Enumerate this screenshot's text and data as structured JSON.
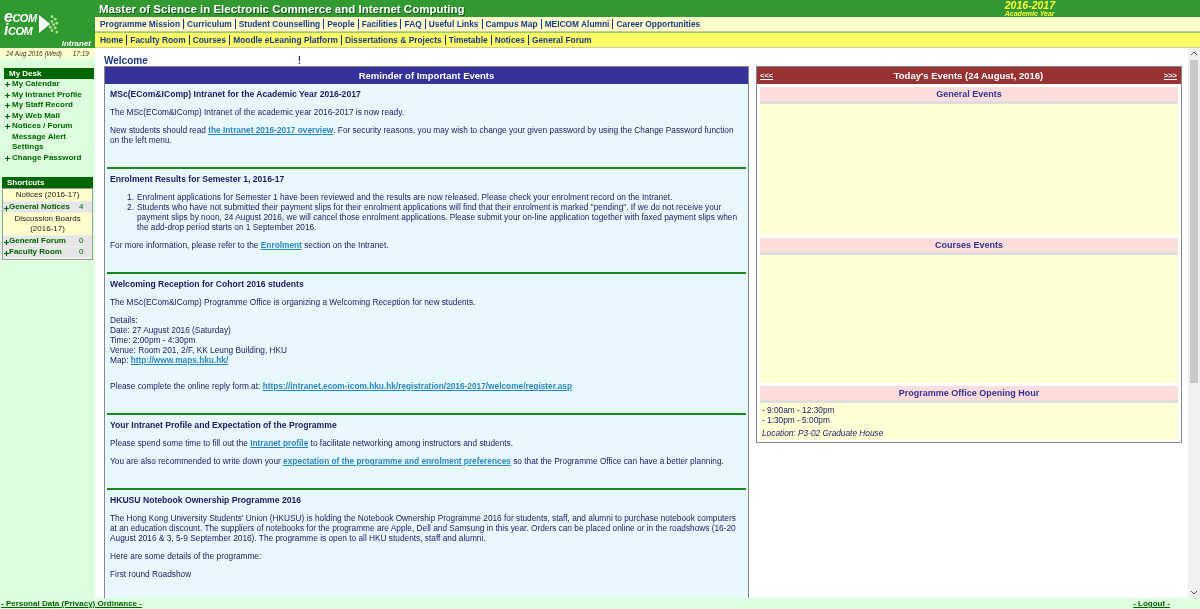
{
  "logo": {
    "top": "eCOM",
    "bottom": "iCOM",
    "tag": "Intranet"
  },
  "header": {
    "title": "Master of Science in Electronic Commerce and Internet Computing",
    "year": "2016-2017",
    "year_caption": "Academic Year"
  },
  "nav_primary": [
    "Programme Mission",
    "Curriculum",
    "Student Counselling",
    "People",
    "Facilities",
    "FAQ",
    "Useful Links",
    "Campus Map",
    "MEICOM Alumni",
    "Career Opportunities"
  ],
  "nav_secondary": [
    "Home",
    "Faculty Room",
    "Courses",
    "Moodle eLeaning Platform",
    "Dissertations & Projects",
    "Timetable",
    "Notices",
    "General Forum"
  ],
  "datetime": {
    "date": "24 Aug 2016 (Wed)",
    "time": "17:19"
  },
  "my_desk": {
    "title": "My Desk",
    "items": [
      {
        "label": "My Calendar"
      },
      {
        "label": "My Intranet Profile"
      },
      {
        "label": "My Staff Record"
      },
      {
        "label": "My Web Mail"
      },
      {
        "label": "Notices / Forum Message Alert Settings"
      },
      {
        "label": "Change Password"
      }
    ]
  },
  "shortcuts": {
    "title": "Shortcuts",
    "rows": [
      {
        "kind": "group",
        "label": "Notices (2016-17)"
      },
      {
        "kind": "link",
        "label": "General Notices",
        "count": "4"
      },
      {
        "kind": "group",
        "label": "Discussion Boards (2016-17)"
      },
      {
        "kind": "link",
        "label": "General Forum",
        "count": "0"
      },
      {
        "kind": "link",
        "label": "Faculty Room",
        "count": "0"
      }
    ]
  },
  "welcome": {
    "greeting": "Welcome",
    "mark": "!"
  },
  "reminder": {
    "title": "Reminder of Important Events",
    "sections": [
      {
        "title": "MSc(ECom&IComp) Intranet for the Academic Year 2016-2017",
        "blocks": [
          {
            "kind": "para",
            "parts": [
              {
                "text": "The MSc(ECom&IComp) Intranet of the academic year 2016-2017 is now ready."
              }
            ]
          },
          {
            "kind": "para",
            "parts": [
              {
                "text": "New students should read "
              },
              {
                "text": "the Intranet 2016-2017 overview",
                "link": true
              },
              {
                "text": ".  For security reasons, you may wish to change your given password by using the Change Password function on the left menu."
              }
            ]
          }
        ]
      },
      {
        "title": "Enrolment Results for Semester 1, 2016-17",
        "blocks": [
          {
            "kind": "list",
            "items": [
              {
                "marker": "1.",
                "text": "Enrolment applications for Semester 1 have been reviewed and the results are now released.  Please check your enrolment record on the Intranet."
              },
              {
                "marker": "2.",
                "text": "Students who have not submitted their payment slips for their enrolment applications will find that their enrolment is marked \"pending\". If we do not receive your payment slips by noon, 24 August 2016, we will cancel those enrolment applications. Please submit your on-line application together with faxed payment slips when the add-drop period starts on 1 September 2016."
              }
            ]
          },
          {
            "kind": "para",
            "parts": [
              {
                "text": "For more information, please refer to the "
              },
              {
                "text": "Enrolment",
                "link": true
              },
              {
                "text": " section on the Intranet."
              }
            ]
          }
        ]
      },
      {
        "title": "Welcoming Reception for Cohort 2016 students",
        "blocks": [
          {
            "kind": "para",
            "parts": [
              {
                "text": "The MSc(ECom&IComp) Programme Office is organizing a Welcoming Reception for new students."
              }
            ]
          },
          {
            "kind": "lines",
            "lines": [
              [
                {
                  "text": "Details:"
                }
              ],
              [
                {
                  "text": "Date: 27 August 2016 (Saturday)"
                }
              ],
              [
                {
                  "text": "Time: 2:00pm - 4:30pm"
                }
              ],
              [
                {
                  "text": "Venue: Room 201, 2/F, KK Leung Building, HKU"
                }
              ],
              [
                {
                  "text": "Map: "
                },
                {
                  "text": "http://www.maps.hku.hk/",
                  "link": true
                }
              ]
            ]
          },
          {
            "kind": "para",
            "parts": [
              {
                "text": "Please complete the online reply form at: "
              },
              {
                "text": "https://intranet.ecom-icom.hku.hk/registration/2016-2017/welcome/register.asp",
                "link": true
              }
            ]
          }
        ]
      },
      {
        "title": "Your Intranet Profile and Expectation of the Programme",
        "blocks": [
          {
            "kind": "para",
            "parts": [
              {
                "text": "Please spend some time to fill out the "
              },
              {
                "text": "Intranet profile",
                "link": true
              },
              {
                "text": " to facilitate networking among instructors and students."
              }
            ]
          },
          {
            "kind": "para",
            "parts": [
              {
                "text": "You are also recommended to write down your "
              },
              {
                "text": "expectation of the programme and enrolment preferences",
                "link": true
              },
              {
                "text": " so that the Programme Office can have a better planning."
              }
            ]
          }
        ]
      },
      {
        "title": "HKUSU Notebook Ownership Programme 2016",
        "blocks": [
          {
            "kind": "para",
            "parts": [
              {
                "text": "The Hong Kong University Students' Union (HKUSU) is holding the Notebook Ownership Programme 2016 for students, staff, and alumni to purchase notebook computers at an education discount. The suppliers of notebooks for the programme are Apple, Dell and Samsung in this year.  Orders can be placed online or in the roadshows (16-20 August 2016 & 3, 5-9 September 2016).  The programme is open to all HKU students, staff and alumni."
              }
            ]
          },
          {
            "kind": "para",
            "parts": [
              {
                "text": "Here are some details of the programme:"
              }
            ]
          },
          {
            "kind": "para",
            "parts": [
              {
                "text": "First round Roadshow"
              }
            ]
          }
        ]
      }
    ]
  },
  "today": {
    "prev": "<<<",
    "title": "Today's Events (24 August, 2016)",
    "next": ">>>",
    "sections": [
      {
        "title": "General Events"
      },
      {
        "title": "Courses Events"
      },
      {
        "title": "Programme Office Opening Hour",
        "lines": [
          "- 9:00am - 12:30pm",
          "- 1:30pm - 5:00pm"
        ],
        "location": "Location: P3-02 Graduate House"
      }
    ]
  },
  "footer": {
    "left": "- Personal Data (Privacy) Ordinance -",
    "right": "- Logout -"
  }
}
